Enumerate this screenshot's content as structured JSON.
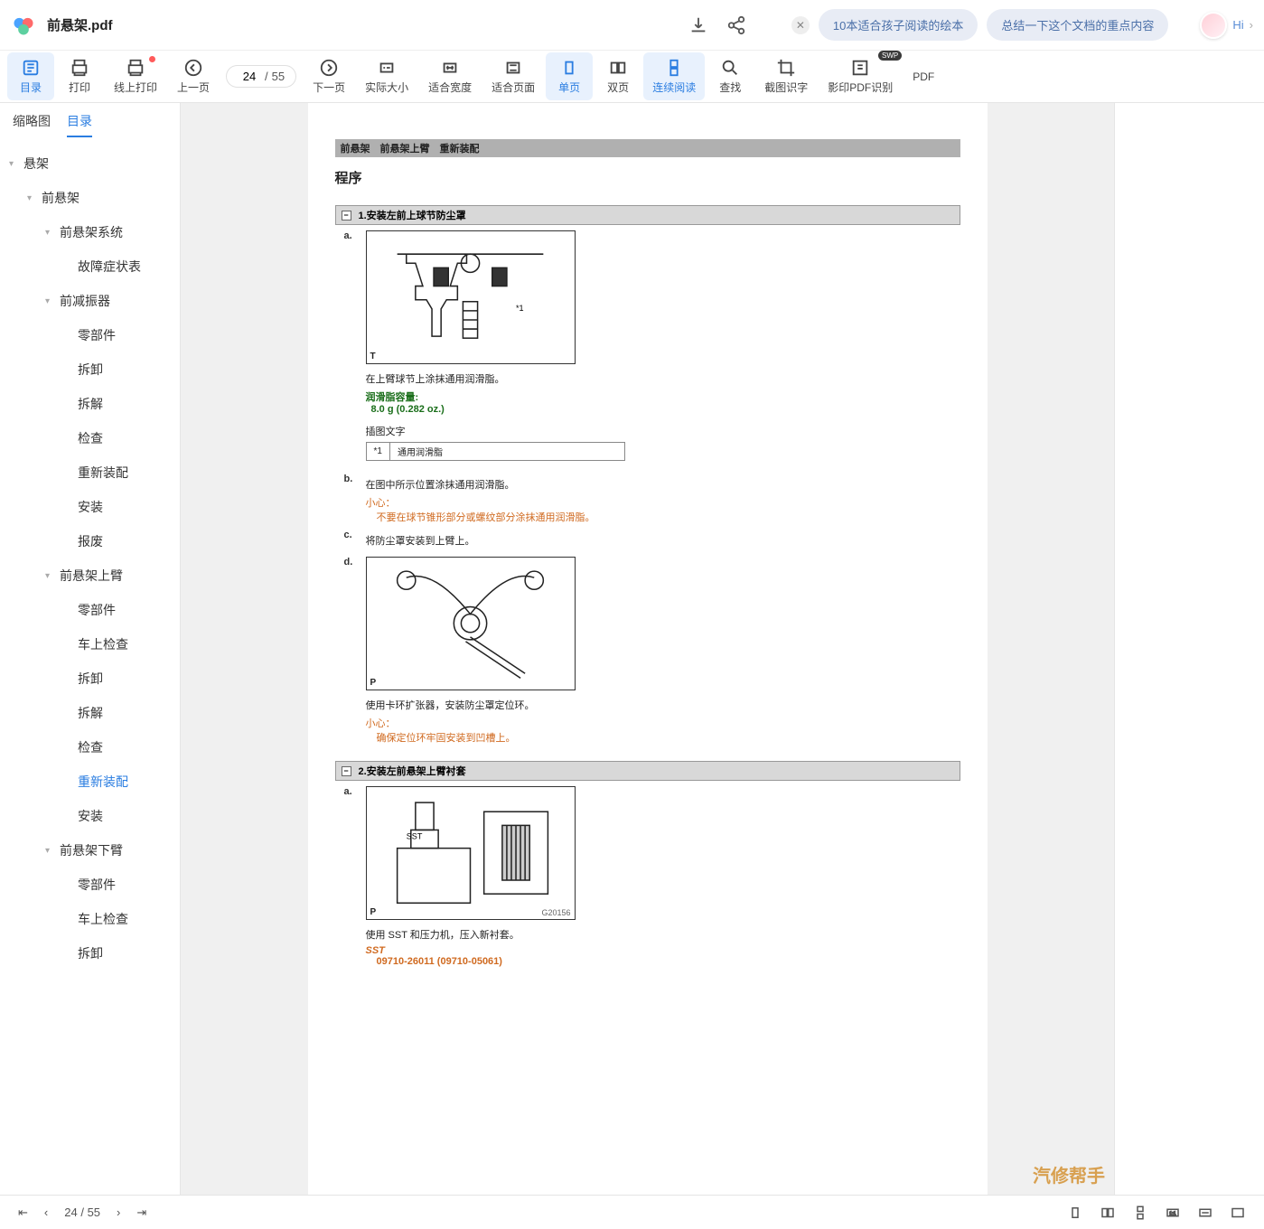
{
  "header": {
    "doc_title": "前悬架.pdf",
    "pills": [
      "10本适合孩子阅读的绘本",
      "总结一下这个文档的重点内容"
    ],
    "hi": "Hi"
  },
  "toolbar": {
    "toc": "目录",
    "print": "打印",
    "online_print": "线上打印",
    "prev": "上一页",
    "next": "下一页",
    "actual": "实际大小",
    "fit_w": "适合宽度",
    "fit_p": "适合页面",
    "single": "单页",
    "double": "双页",
    "continuous": "连续阅读",
    "find": "查找",
    "ocr_crop": "截图识字",
    "ocr_pdf": "影印PDF识别",
    "pdf": "PDF",
    "page_current": "24",
    "page_total": "55",
    "swp": "SWP"
  },
  "sidebar": {
    "tabs": {
      "thumb": "缩略图",
      "toc": "目录"
    },
    "tree": [
      {
        "level": 0,
        "caret": true,
        "label": "悬架"
      },
      {
        "level": 1,
        "caret": true,
        "label": "前悬架"
      },
      {
        "level": 2,
        "caret": true,
        "label": "前悬架系统"
      },
      {
        "level": 3,
        "label": "故障症状表"
      },
      {
        "level": 2,
        "caret": true,
        "label": "前减振器"
      },
      {
        "level": 3,
        "label": "零部件"
      },
      {
        "level": 3,
        "label": "拆卸"
      },
      {
        "level": 3,
        "label": "拆解"
      },
      {
        "level": 3,
        "label": "检查"
      },
      {
        "level": 3,
        "label": "重新装配"
      },
      {
        "level": 3,
        "label": "安装"
      },
      {
        "level": 3,
        "label": "报废"
      },
      {
        "level": 2,
        "caret": true,
        "label": "前悬架上臂"
      },
      {
        "level": 3,
        "label": "零部件"
      },
      {
        "level": 3,
        "label": "车上检查"
      },
      {
        "level": 3,
        "label": "拆卸"
      },
      {
        "level": 3,
        "label": "拆解"
      },
      {
        "level": 3,
        "label": "检查"
      },
      {
        "level": 3,
        "label": "重新装配",
        "selected": true
      },
      {
        "level": 3,
        "label": "安装"
      },
      {
        "level": 2,
        "caret": true,
        "label": "前悬架下臂"
      },
      {
        "level": 3,
        "label": "零部件"
      },
      {
        "level": 3,
        "label": "车上检查"
      },
      {
        "level": 3,
        "label": "拆卸"
      }
    ]
  },
  "doc": {
    "breadcrumb": "前悬架　前悬架上臂　重新装配",
    "proc_title": "程序",
    "step1_title": "1.安装左前上球节防尘罩",
    "a_label": "a.",
    "a_marker": "*1",
    "a_corner": "T",
    "a_text": "在上臂球节上涂抹通用润滑脂。",
    "a_green1": "润滑脂容量:",
    "a_green2": "8.0 g (0.282 oz.)",
    "a_caption": "插图文字",
    "a_table_k": "*1",
    "a_table_v": "通用润滑脂",
    "b_label": "b.",
    "b_text": "在图中所示位置涂抹通用润滑脂。",
    "b_caution": "小心：",
    "b_caution_t": "不要在球节锥形部分或螺纹部分涂抹通用润滑脂。",
    "c_label": "c.",
    "c_text": "将防尘罩安装到上臂上。",
    "d_label": "d.",
    "d_corner": "P",
    "d_text": "使用卡环扩张器，安装防尘罩定位环。",
    "d_caution": "小心：",
    "d_caution_t": "确保定位环牢固安装到凹槽上。",
    "step2_title": "2.安装左前悬架上臂衬套",
    "a2_label": "a.",
    "a2_sst": "SST",
    "a2_corner": "P",
    "a2_code": "G20156",
    "a2_text": "使用 SST 和压力机，压入新衬套。",
    "a2_sst_label": "SST",
    "a2_sst_code": "09710-26011  (09710-05061)"
  },
  "status": {
    "page_current": "24",
    "page_total": "55"
  },
  "watermark": "汽修帮手"
}
